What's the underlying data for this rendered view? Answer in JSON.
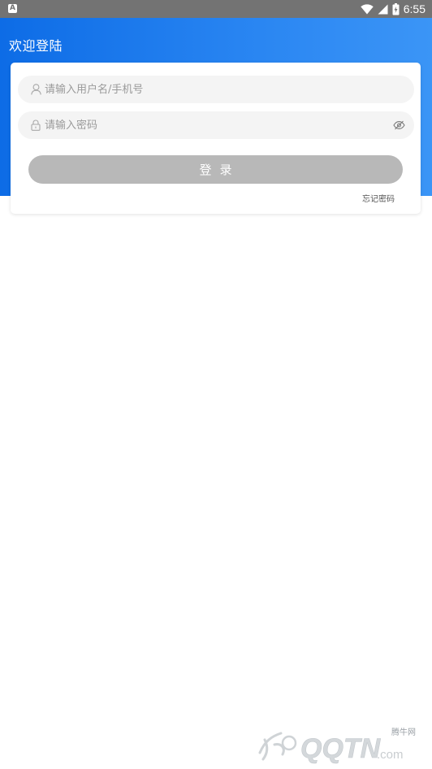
{
  "status_bar": {
    "app_icon_glyph": "A",
    "time": "6:55",
    "icons": [
      "wifi-icon",
      "signal-icon",
      "battery-icon"
    ]
  },
  "header": {
    "title": "欢迎登陆",
    "gradient_start": "#0d6ce6",
    "gradient_end": "#3b95f6"
  },
  "login_form": {
    "username": {
      "placeholder": "请输入用户名/手机号",
      "value": "",
      "icon": "user-icon"
    },
    "password": {
      "placeholder": "请输入密码",
      "value": "",
      "icon": "lock-icon",
      "toggle_icon": "eye-off-icon"
    },
    "submit_label": "登录",
    "submit_color": "#b8b8b8",
    "forgot_label": "忘记密码"
  },
  "watermark": {
    "brand": "QQTN",
    "suffix": ".com",
    "small_text": "腾牛网"
  }
}
